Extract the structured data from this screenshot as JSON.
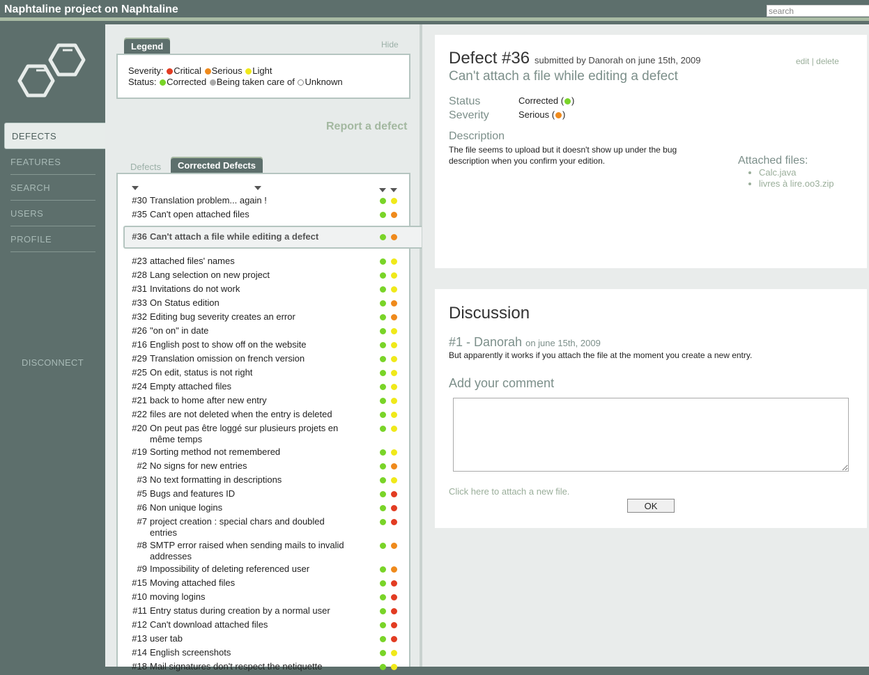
{
  "app": {
    "title": "Naphtaline project on Naphtaline"
  },
  "search": {
    "placeholder": "search"
  },
  "sidebar": {
    "logo_icon": "naphthalene-logo-icon",
    "items": [
      {
        "label": "DEFECTS",
        "active": true
      },
      {
        "label": "FEATURES"
      },
      {
        "label": "SEARCH"
      },
      {
        "label": "USERS"
      },
      {
        "label": "PROFILE"
      }
    ],
    "disconnect": "DISCONNECT"
  },
  "legend": {
    "tab": "Legend",
    "hide": "Hide",
    "severity_label": "Severity:",
    "severity": {
      "critical": "Critical",
      "serious": "Serious",
      "light": "Light"
    },
    "status_label": "Status:",
    "status": {
      "corrected": "Corrected",
      "in_progress": "Being taken care of",
      "unknown": "Unknown"
    }
  },
  "report_link": "Report a defect",
  "list_tabs": {
    "defects": "Defects",
    "corrected": "Corrected Defects"
  },
  "colors": {
    "critical": "#e23c22",
    "serious": "#ef8a1c",
    "light": "#f0e91a",
    "corrected": "#79d428",
    "in_progress": "#aaaaaa",
    "accent": "#5d6f6c"
  },
  "defects": [
    {
      "id": "#30",
      "title": "Translation problem... again !",
      "status": "corrected",
      "severity": "light"
    },
    {
      "id": "#35",
      "title": "Can't open attached files",
      "status": "corrected",
      "severity": "serious"
    },
    {
      "id": "#36",
      "title": "Can't attach a file while editing a defect",
      "status": "corrected",
      "severity": "serious",
      "selected": true
    },
    {
      "id": "#23",
      "title": "attached files' names",
      "status": "corrected",
      "severity": "light"
    },
    {
      "id": "#28",
      "title": "Lang selection on new project",
      "status": "corrected",
      "severity": "light"
    },
    {
      "id": "#31",
      "title": "Invitations do not work",
      "status": "corrected",
      "severity": "light"
    },
    {
      "id": "#33",
      "title": "On Status edition",
      "status": "corrected",
      "severity": "serious"
    },
    {
      "id": "#32",
      "title": "Editing bug severity creates an error",
      "status": "corrected",
      "severity": "serious"
    },
    {
      "id": "#26",
      "title": "\"on on\" in date",
      "status": "corrected",
      "severity": "light"
    },
    {
      "id": "#16",
      "title": "English post to show off on the website",
      "status": "corrected",
      "severity": "light"
    },
    {
      "id": "#29",
      "title": "Translation omission on french version",
      "status": "corrected",
      "severity": "light"
    },
    {
      "id": "#25",
      "title": "On edit, status is not right",
      "status": "corrected",
      "severity": "light"
    },
    {
      "id": "#24",
      "title": "Empty attached files",
      "status": "corrected",
      "severity": "light"
    },
    {
      "id": "#21",
      "title": "back to home after new entry",
      "status": "corrected",
      "severity": "light"
    },
    {
      "id": "#22",
      "title": "files are not deleted when the entry is deleted",
      "status": "corrected",
      "severity": "light"
    },
    {
      "id": "#20",
      "title": "On peut pas être loggé sur plusieurs projets en même temps",
      "status": "corrected",
      "severity": "light"
    },
    {
      "id": "#19",
      "title": "Sorting method not remembered",
      "status": "corrected",
      "severity": "light"
    },
    {
      "id": "#2",
      "title": "No signs for new entries",
      "status": "corrected",
      "severity": "serious"
    },
    {
      "id": "#3",
      "title": "No text formatting in descriptions",
      "status": "corrected",
      "severity": "light"
    },
    {
      "id": "#5",
      "title": "Bugs and features ID",
      "status": "corrected",
      "severity": "critical"
    },
    {
      "id": "#6",
      "title": "Non unique logins",
      "status": "corrected",
      "severity": "critical"
    },
    {
      "id": "#7",
      "title": "project creation : special chars and doubled entries",
      "status": "corrected",
      "severity": "critical"
    },
    {
      "id": "#8",
      "title": "SMTP error raised when sending mails to invalid addresses",
      "status": "corrected",
      "severity": "serious"
    },
    {
      "id": "#9",
      "title": "Impossibility of deleting referenced user",
      "status": "corrected",
      "severity": "serious"
    },
    {
      "id": "#15",
      "title": "Moving attached files",
      "status": "corrected",
      "severity": "critical"
    },
    {
      "id": "#10",
      "title": "moving logins",
      "status": "corrected",
      "severity": "critical"
    },
    {
      "id": "#11",
      "title": "Entry status during creation by a normal user",
      "status": "corrected",
      "severity": "critical"
    },
    {
      "id": "#12",
      "title": "Can't download attached files",
      "status": "corrected",
      "severity": "critical"
    },
    {
      "id": "#13",
      "title": "user tab",
      "status": "corrected",
      "severity": "critical"
    },
    {
      "id": "#14",
      "title": "English screenshots",
      "status": "corrected",
      "severity": "light"
    },
    {
      "id": "#18",
      "title": "Mail signatures don't respect the netiquette",
      "status": "corrected",
      "severity": "light"
    }
  ],
  "detail": {
    "title": "Defect #36",
    "submitted": "submitted by Danorah on june 15th, 2009",
    "heading": "Can't attach a file while editing a defect",
    "edit": "edit",
    "separator": "|",
    "delete": "delete",
    "status_label": "Status",
    "status_value": "Corrected (",
    "severity_label": "Severity",
    "severity_value": "Serious (",
    "paren_close": ")",
    "description_label": "Description",
    "description": "The file seems to upload but it doesn't show up under the bug description when you confirm your edition.",
    "files_label": "Attached files:",
    "files": [
      "Calc.java",
      "livres à lire.oo3.zip"
    ]
  },
  "discussion": {
    "title": "Discussion",
    "entry_head": "#1 - Danorah",
    "entry_date": "on june 15th, 2009",
    "entry_text": "But apparently it works if you attach the file at the moment you create a new entry.",
    "add_comment": "Add your comment",
    "attach_link": "Click here to attach a new file.",
    "ok": "OK"
  }
}
